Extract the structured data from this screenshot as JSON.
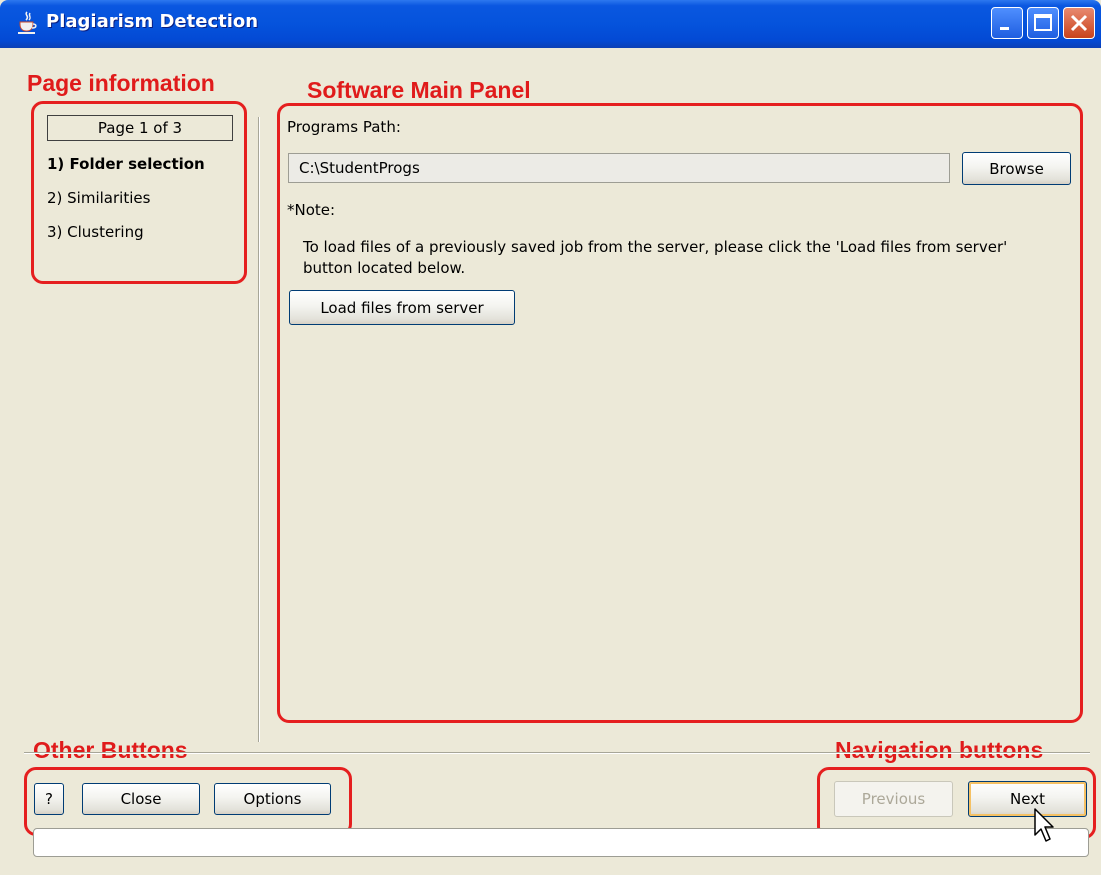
{
  "window": {
    "title": "Plagiarism Detection"
  },
  "annotations": {
    "page_information": "Page information",
    "software_main_panel": "Software Main Panel",
    "other_buttons": "Other Buttons",
    "navigation_buttons": "Navigation buttons",
    "color": "#e51f1f"
  },
  "sidebar": {
    "page_indicator": "Page 1 of 3",
    "steps": [
      {
        "label": "1) Folder selection",
        "active": true
      },
      {
        "label": "2) Similarities",
        "active": false
      },
      {
        "label": "3) Clustering",
        "active": false
      }
    ]
  },
  "main": {
    "programs_path_label": "Programs Path:",
    "programs_path_value": "C:\\StudentProgs",
    "browse_label": "Browse",
    "note_label": "*Note:",
    "note_line1": "To load files of a previously saved job from the server, please click the 'Load files from server'",
    "note_line2": "button located below.",
    "load_button_label": "Load files from server"
  },
  "footer": {
    "help_label": "?",
    "close_label": "Close",
    "options_label": "Options",
    "previous_label": "Previous",
    "next_label": "Next",
    "progress": 0
  },
  "icons": {
    "app": "java-coffee-cup-icon",
    "minimize": "minimize-icon",
    "maximize": "maximize-icon",
    "close": "close-icon",
    "cursor": "mouse-pointer-icon"
  }
}
